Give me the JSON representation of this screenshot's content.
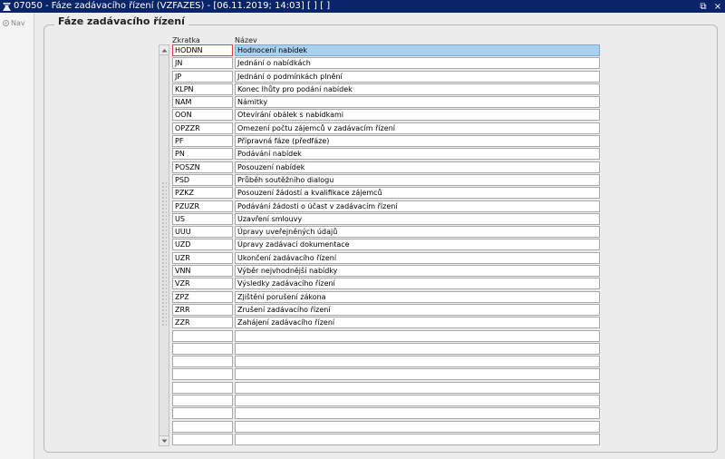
{
  "window": {
    "title": "07050 - Fáze zadávacího řízení (VZFAZES) - [06.11.2019; 14:03]  [ ]  [ ]",
    "app_icon": "app-logo-icon",
    "controls": [
      "restore-icon",
      "close-icon"
    ],
    "close_glyph": "×",
    "restore_glyph": "⧉"
  },
  "sidebar": {
    "nav_label": "Nav",
    "nav_icon": "nav-icon"
  },
  "form": {
    "group_title": "Fáze zadávacího řízení",
    "col_code": "Zkratka",
    "col_name": "Název",
    "rows": [
      {
        "code": "HODNN",
        "name": "Hodnocení nabídek"
      },
      {
        "code": "JN",
        "name": "Jednání o nabídkách"
      },
      {
        "code": "JP",
        "name": "Jednání o podmínkách plnění"
      },
      {
        "code": "KLPN",
        "name": "Konec lhůty pro podání nabídek"
      },
      {
        "code": "NAM",
        "name": "Námitky"
      },
      {
        "code": "OON",
        "name": "Otevírání obálek s nabídkami"
      },
      {
        "code": "OPZZR",
        "name": "Omezení počtu zájemců v zadávacím řízení"
      },
      {
        "code": "PF",
        "name": "Přípravná fáze (předfáze)"
      },
      {
        "code": "PN",
        "name": "Podávání nabídek"
      },
      {
        "code": "POSZN",
        "name": "Posouzení nabídek"
      },
      {
        "code": "PSD",
        "name": "Průběh soutěžního dialogu"
      },
      {
        "code": "PZKZ",
        "name": "Posouzení žádostí a kvalifikace zájemců"
      },
      {
        "code": "PZUZR",
        "name": "Podávání žádostí o účast v zadávacím řízení"
      },
      {
        "code": "US",
        "name": "Uzavření smlouvy"
      },
      {
        "code": "UUU",
        "name": "Úpravy uveřejněných údajů"
      },
      {
        "code": "UZD",
        "name": "Úpravy zadávací dokumentace"
      },
      {
        "code": "UZR",
        "name": "Ukončení zadávacího řízení"
      },
      {
        "code": "VNN",
        "name": "Výběr nejvhodnější nabídky"
      },
      {
        "code": "VZR",
        "name": "Výsledky zadávacího řízení"
      },
      {
        "code": "ZPZ",
        "name": "Zjištění porušení zákona"
      },
      {
        "code": "ZRR",
        "name": "Zrušení zadávacího řízení"
      },
      {
        "code": "ZZR",
        "name": "Zahájení zadávacího řízení"
      },
      {
        "code": "",
        "name": ""
      },
      {
        "code": "",
        "name": ""
      },
      {
        "code": "",
        "name": ""
      },
      {
        "code": "",
        "name": ""
      },
      {
        "code": "",
        "name": ""
      },
      {
        "code": "",
        "name": ""
      },
      {
        "code": "",
        "name": ""
      },
      {
        "code": "",
        "name": ""
      },
      {
        "code": "",
        "name": ""
      }
    ],
    "selected_row": 0
  },
  "colors": {
    "titlebar": "#0a246a",
    "selection": "#a8d1f0",
    "focus_border": "#e04040"
  }
}
